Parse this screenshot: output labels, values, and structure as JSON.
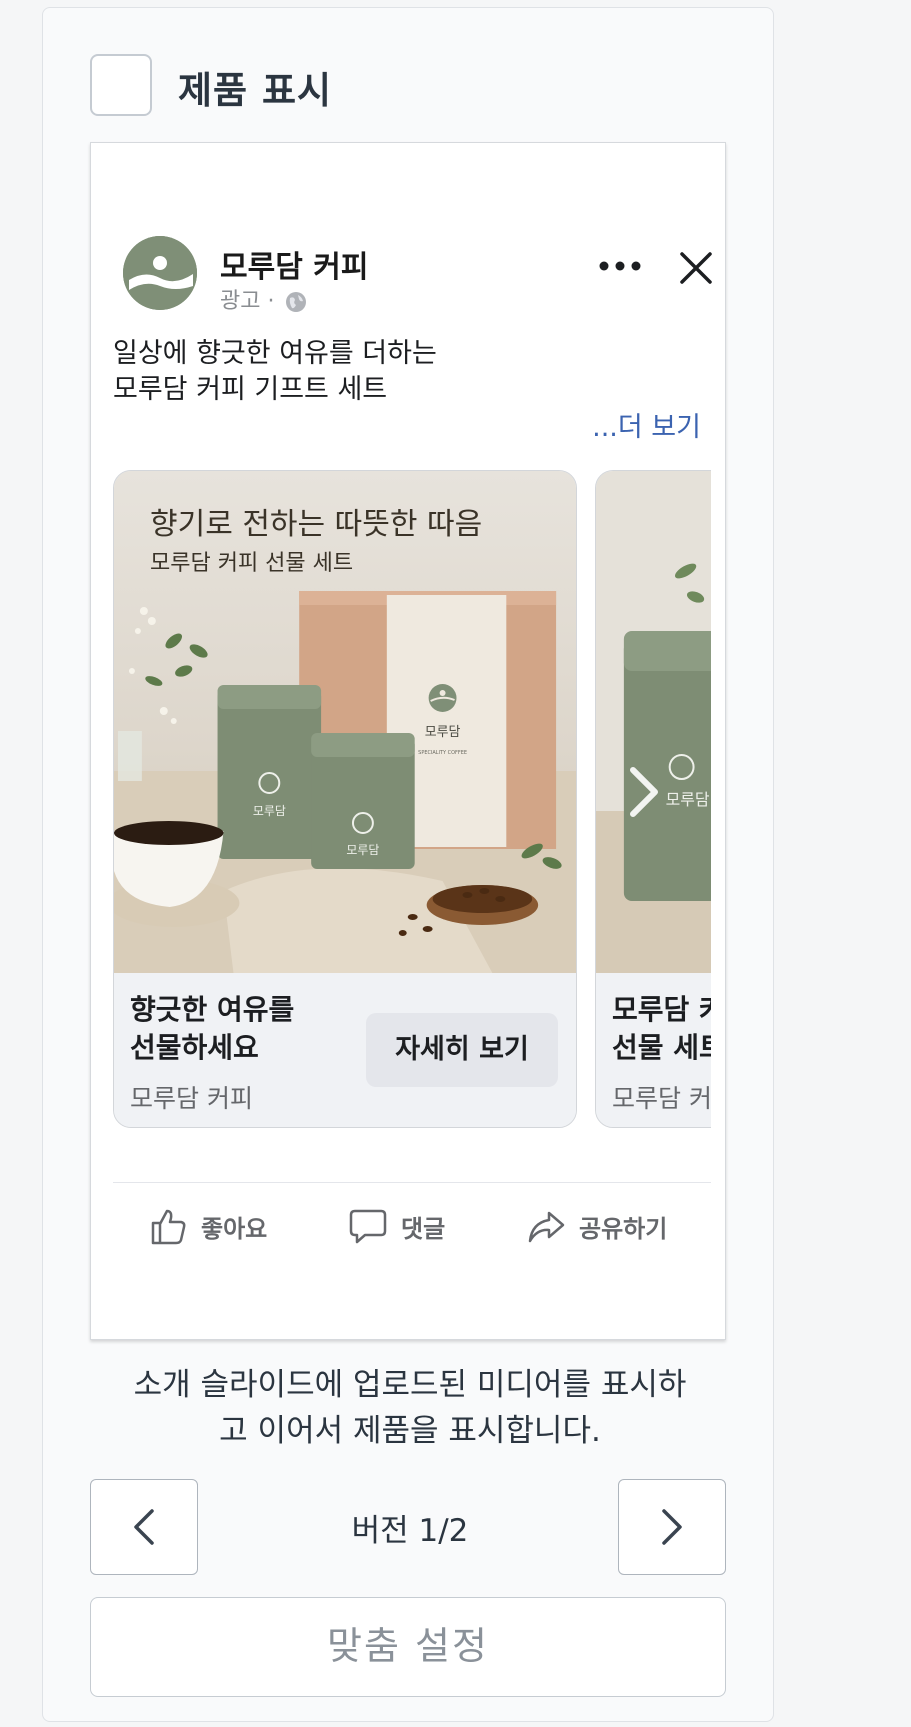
{
  "panel": {
    "title": "제품 표시",
    "description": "소개 슬라이드에 업로드된 미디어를 표시하\n고 이어서 제품을 표시합니다.",
    "version_label": "버전 1/2",
    "customize_label": "맞춤 설정"
  },
  "ad": {
    "page_name": "모루담 커피",
    "sponsored": "광고 ·",
    "text_line1": "일상에 향긋한 여유를 더하는",
    "text_line2": "모루담 커피 기프트 세트",
    "see_more": "...더 보기",
    "cards": [
      {
        "image_title": "향기로 전하는 따뜻한 따음",
        "image_subtitle": "모루담 커피 선물 세트",
        "box_brand": "모루담",
        "box_tagline": "SPECIALITY COFFEE",
        "can_label": "모루담",
        "headline": "향긋한 여유를\n선물하세요",
        "brand": "모루담 커피",
        "cta": "자세히 보기"
      },
      {
        "can_label": "모루담",
        "headline": "모루담 커\n선물 세트",
        "brand": "모루담 커피"
      }
    ],
    "actions": {
      "like": "좋아요",
      "comment": "댓글",
      "share": "공유하기"
    }
  },
  "colors": {
    "sage": "#7f8f77",
    "link_blue": "#3b63b0"
  }
}
